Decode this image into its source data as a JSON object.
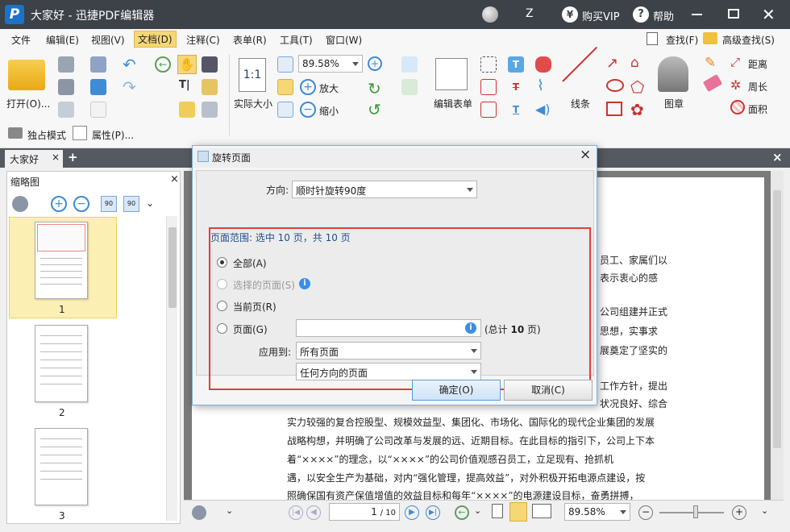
{
  "app": {
    "title": "大家好 - 迅捷PDF编辑器",
    "user_initial": "Z",
    "buy_vip": "购买VIP",
    "help": "帮助"
  },
  "menu": [
    "文件",
    "编辑(E)",
    "视图(V)",
    "文档(D)",
    "注释(C)",
    "表单(R)",
    "工具(T)",
    "窗口(W)"
  ],
  "search": {
    "find": "查找(F)",
    "advanced_find": "高级查找(S)"
  },
  "toolbar": {
    "open": "打开(O)...",
    "zoom_value": "89.58%",
    "actual_size": "实际大小",
    "zoom_in": "放大",
    "zoom_out": "缩小",
    "edit_form": "编辑表单",
    "line": "线条",
    "stamp": "图章",
    "distance": "距离",
    "perimeter": "周长",
    "area": "面积",
    "exclusive_mode": "独占模式",
    "properties": "属性(P)..."
  },
  "tabs": {
    "document": "大家好"
  },
  "sidebar": {
    "title": "缩略图",
    "pages": [
      "1",
      "2",
      "3"
    ]
  },
  "dialog": {
    "title": "旋转页面",
    "direction_label": "方向:",
    "direction_value": "顺时针旋转90度",
    "range_label": "页面范围: 选中 10 页，共 10 页",
    "opt_all": "全部(A)",
    "opt_selected": "选择的页面(S)",
    "opt_current": "当前页(R)",
    "opt_pages": "页面(G)",
    "pages_input": "",
    "total_prefix": "(总计",
    "total_count": "10",
    "total_suffix": "页)",
    "apply_label": "应用到:",
    "apply_value": "所有页面",
    "orientation_value": "任何方向的页面",
    "ok": "确定(O)",
    "cancel": "取消(C)"
  },
  "doc_text": [
    "员工、家属们以",
    "表示衷心的感",
    "公司组建并正式",
    "思想，实事求",
    "展奠定了坚实的",
    "工作方针，提出",
    "状况良好、综合",
    "实力较强的复合控股型、规模效益型、集团化、市场化、国际化的现代企业集团的发展",
    "战略构想，并明确了公司改革与发展的远、近期目标。在此目标的指引下，公司上下本",
    "着“××××”的理念，以“××××”的公司价值观感召员工，立足现有、抢抓机",
    "遇，以安全生产为基础，对内“强化管理，提高效益”，对外积极开拓电源点建设，按",
    "照确保国有资产保值增值的效益目标和每年“××××”的电源建设目标，奋勇拼搏，"
  ],
  "status": {
    "page_input": "1",
    "page_total": "/ 10",
    "zoom": "89.58%"
  }
}
